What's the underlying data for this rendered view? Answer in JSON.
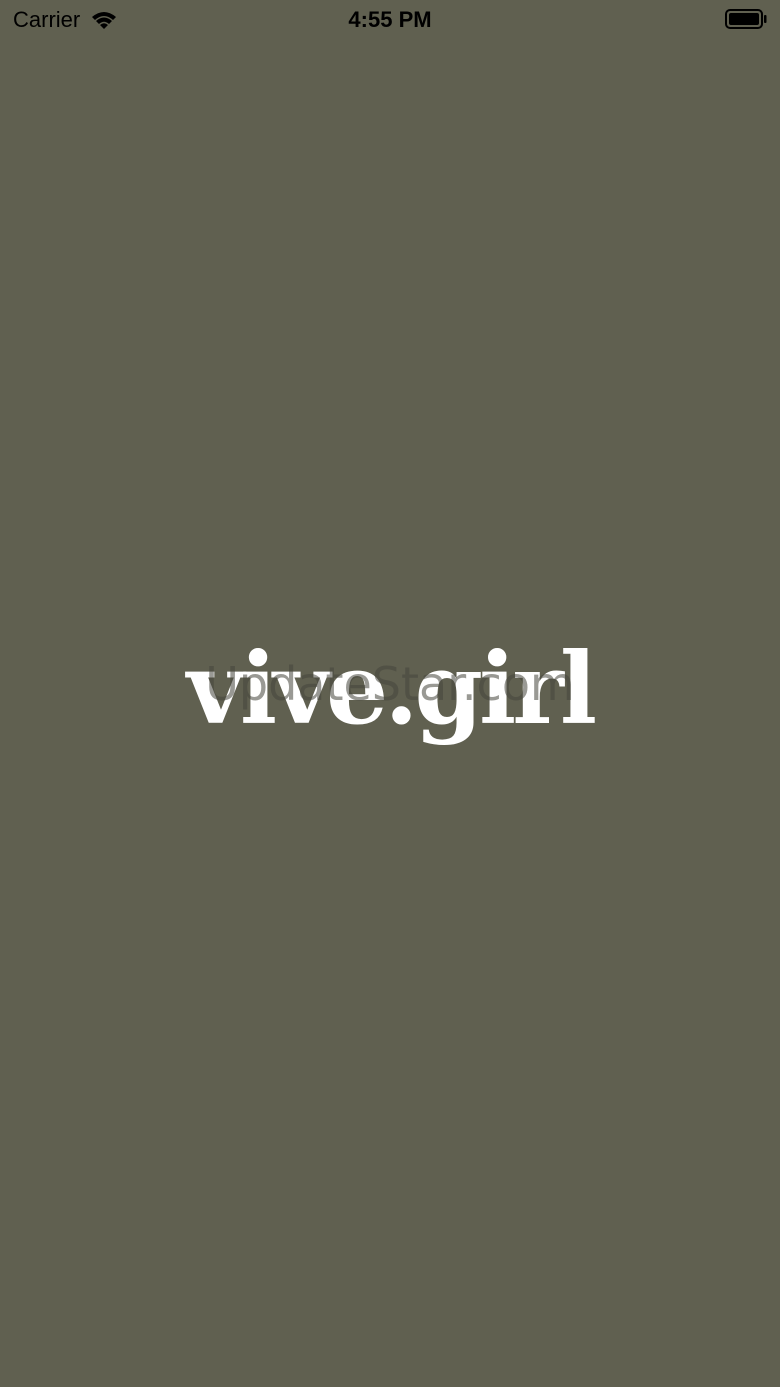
{
  "status_bar": {
    "carrier": "Carrier",
    "time": "4:55 PM",
    "icons": {
      "wifi": "wifi-icon",
      "battery": "battery-icon"
    }
  },
  "splash": {
    "logo_text": "vive.girl",
    "background_color": "#606050",
    "logo_color": "#ffffff"
  },
  "watermark": {
    "text": "UpdateStar.com"
  }
}
